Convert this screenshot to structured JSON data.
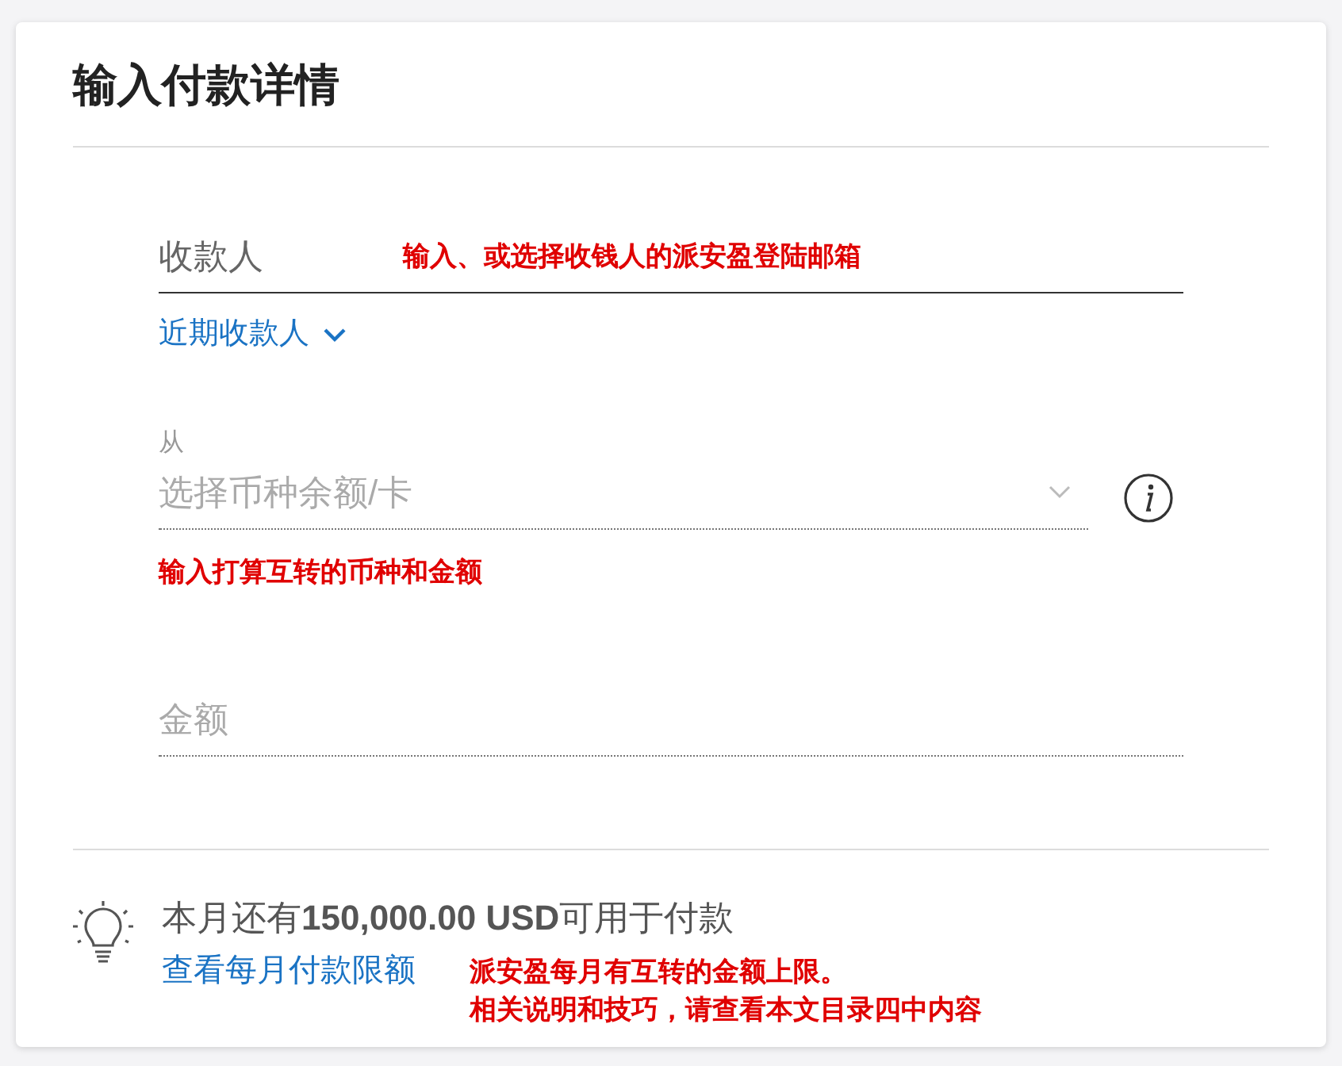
{
  "title": "输入付款详情",
  "payee": {
    "placeholder": "收款人",
    "annotation": "输入、或选择收钱人的派安盈登陆邮箱"
  },
  "recent_payees": {
    "label": "近期收款人",
    "expanded": false
  },
  "source": {
    "label": "从",
    "placeholder": "选择币种余额/卡",
    "annotation": "输入打算互转的币种和金额"
  },
  "amount": {
    "placeholder": "金额"
  },
  "limit": {
    "text": "本月还有**150,000.00 USD**可用于付款",
    "link": "查看每月付款限额",
    "annotations": [
      "派安盈每月有互转的金额上限。",
      "相关说明和技巧，请查看本文目录四中内容"
    ]
  }
}
